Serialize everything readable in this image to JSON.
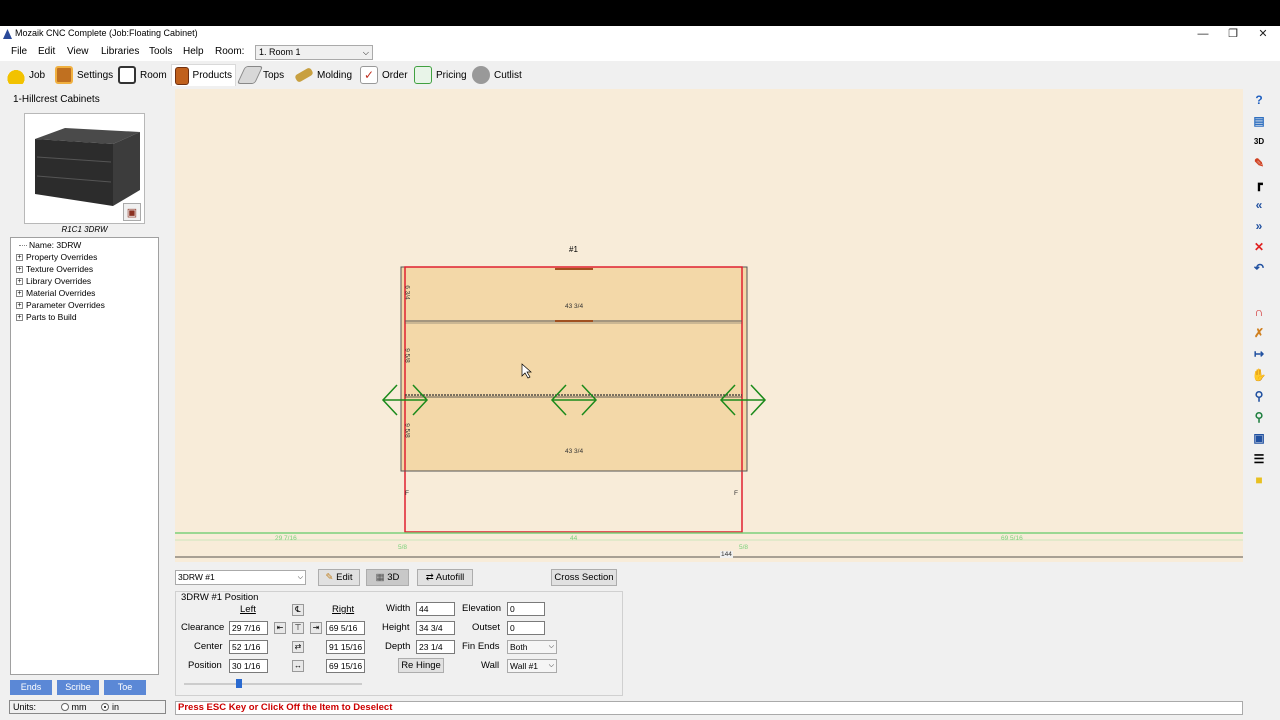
{
  "window": {
    "title": "Mozaik CNC Complete (Job:Floating Cabinet)"
  },
  "menu": {
    "items": [
      "File",
      "Edit",
      "View",
      "Libraries",
      "Tools",
      "Help"
    ],
    "room_label": "Room:",
    "room_value": "1. Room 1"
  },
  "toolbar": {
    "items": [
      {
        "label": "Job",
        "icon": "job-hardhat-icon",
        "color": "#e8b400"
      },
      {
        "label": "Settings",
        "icon": "settings-icon",
        "color": "#c07020"
      },
      {
        "label": "Room",
        "icon": "room-icon",
        "color": "#444444"
      },
      {
        "label": "Products",
        "icon": "products-icon",
        "color": "#c0601c"
      },
      {
        "label": "Tops",
        "icon": "tops-icon",
        "color": "#a0a0a0"
      },
      {
        "label": "Molding",
        "icon": "molding-icon",
        "color": "#c8a040"
      },
      {
        "label": "Order",
        "icon": "order-icon",
        "color": "#c03020"
      },
      {
        "label": "Pricing",
        "icon": "pricing-icon",
        "color": "#40a040"
      },
      {
        "label": "Cutlist",
        "icon": "cutlist-icon",
        "color": "#808080"
      }
    ],
    "active": "Products"
  },
  "sidebar": {
    "company": "1-Hillcrest Cabinets",
    "thumb_caption": "R1C1 3DRW",
    "tree": {
      "name": "Name: 3DRW",
      "items": [
        "Property Overrides",
        "Texture Overrides",
        "Library Overrides",
        "Material Overrides",
        "Parameter Overrides",
        "Parts to Build"
      ]
    },
    "buttons": [
      "Ends",
      "Scribe",
      "Toe"
    ],
    "units": {
      "label": "Units:",
      "mm": "mm",
      "in": "in",
      "selected": "in"
    }
  },
  "drawing": {
    "product_label": "#1",
    "top_width": "43 3/4",
    "bottom_width": "43 3/4",
    "drawer_heights": [
      "6 3/4",
      "9 5/8",
      "9 5/8"
    ],
    "fin_marks": [
      "F",
      "F"
    ],
    "dims": {
      "left": "29 7/16",
      "left_small": "5/8",
      "middle": "44",
      "right_small": "5/8",
      "right": "69 5/16",
      "total": "144"
    }
  },
  "bottom": {
    "product_select": "3DRW #1",
    "edit_label": "Edit",
    "view3d_label": "3D",
    "autofill_label": "Autofill",
    "cross_section_label": "Cross Section",
    "position_title": "3DRW #1 Position",
    "left_header": "Left",
    "right_header": "Right",
    "rows": [
      {
        "label": "Clearance",
        "left": "29 7/16",
        "right": "69 5/16"
      },
      {
        "label": "Center",
        "left": "52 1/16",
        "right": "91 15/16"
      },
      {
        "label": "Position",
        "left": "30 1/16",
        "right": "69 15/16"
      }
    ],
    "dims": [
      {
        "label": "Width",
        "value": "44"
      },
      {
        "label": "Height",
        "value": "34 3/4"
      },
      {
        "label": "Depth",
        "value": "23 1/4"
      }
    ],
    "rehinge_label": "Re Hinge",
    "elevation": {
      "label": "Elevation",
      "value": "0"
    },
    "outset": {
      "label": "Outset",
      "value": "0"
    },
    "fin_ends": {
      "label": "Fin Ends",
      "value": "Both"
    },
    "wall": {
      "label": "Wall",
      "value": "Wall #1"
    },
    "slider_level": 0.3
  },
  "status": {
    "message": "Press ESC Key or Click Off the Item to Deselect"
  },
  "right_tools": [
    "help-icon",
    "save-icon",
    "3d-view-icon",
    "pencil-icon",
    "wall-icon",
    "rewind-icon",
    "fast-forward-icon",
    "delete-icon",
    "undo-icon",
    "magnet-icon",
    "tools-icon",
    "dimension-icon",
    "hand-icon",
    "zoom-icon",
    "zoom-fit-icon",
    "zoom-extents-icon",
    "layers-icon",
    "note-icon"
  ]
}
